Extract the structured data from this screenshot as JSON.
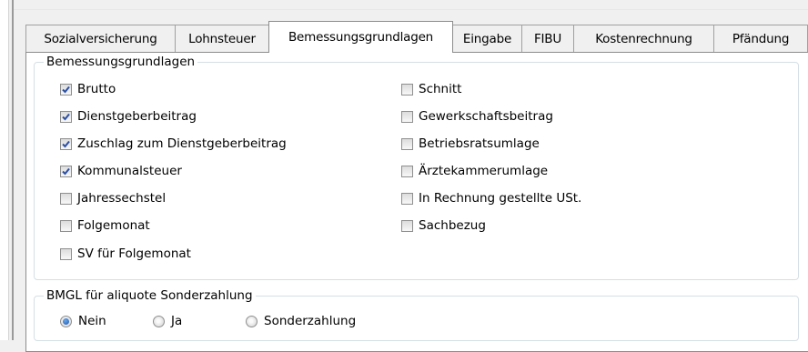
{
  "tabs": [
    {
      "label": "Sozialversicherung",
      "active": false
    },
    {
      "label": "Lohnsteuer",
      "active": false
    },
    {
      "label": "Bemessungsgrundlagen",
      "active": true
    },
    {
      "label": "Eingabe",
      "active": false
    },
    {
      "label": "FIBU",
      "active": false
    },
    {
      "label": "Kostenrechnung",
      "active": false
    },
    {
      "label": "Pfändung",
      "active": false
    }
  ],
  "bmgl_group": {
    "title": "Bemessungsgrundlagen",
    "left_column": [
      {
        "label": "Brutto",
        "checked": true
      },
      {
        "label": "Dienstgeberbeitrag",
        "checked": true
      },
      {
        "label": "Zuschlag zum Dienstgeberbeitrag",
        "checked": true
      },
      {
        "label": "Kommunalsteuer",
        "checked": true
      },
      {
        "label": "Jahressechstel",
        "checked": false
      },
      {
        "label": "Folgemonat",
        "checked": false
      },
      {
        "label": "SV für Folgemonat",
        "checked": false
      }
    ],
    "right_column": [
      {
        "label": "Schnitt",
        "checked": false
      },
      {
        "label": "Gewerkschaftsbeitrag",
        "checked": false
      },
      {
        "label": "Betriebsratsumlage",
        "checked": false
      },
      {
        "label": "Ärztekammerumlage",
        "checked": false
      },
      {
        "label": "In Rechnung gestellte USt.",
        "checked": false
      },
      {
        "label": "Sachbezug",
        "checked": false
      }
    ]
  },
  "aliquot_group": {
    "title": "BMGL für aliquote Sonderzahlung",
    "options": [
      {
        "label": "Nein",
        "selected": true
      },
      {
        "label": "Ja",
        "selected": false
      },
      {
        "label": "Sonderzahlung",
        "selected": false
      }
    ]
  },
  "colors": {
    "check_blue": "#2c4fa3",
    "radio_blue": "#1c57b0",
    "border": "#8c8c8c"
  },
  "icons": {
    "checked": "checkmark-icon",
    "radio": "radio-dot-icon"
  }
}
